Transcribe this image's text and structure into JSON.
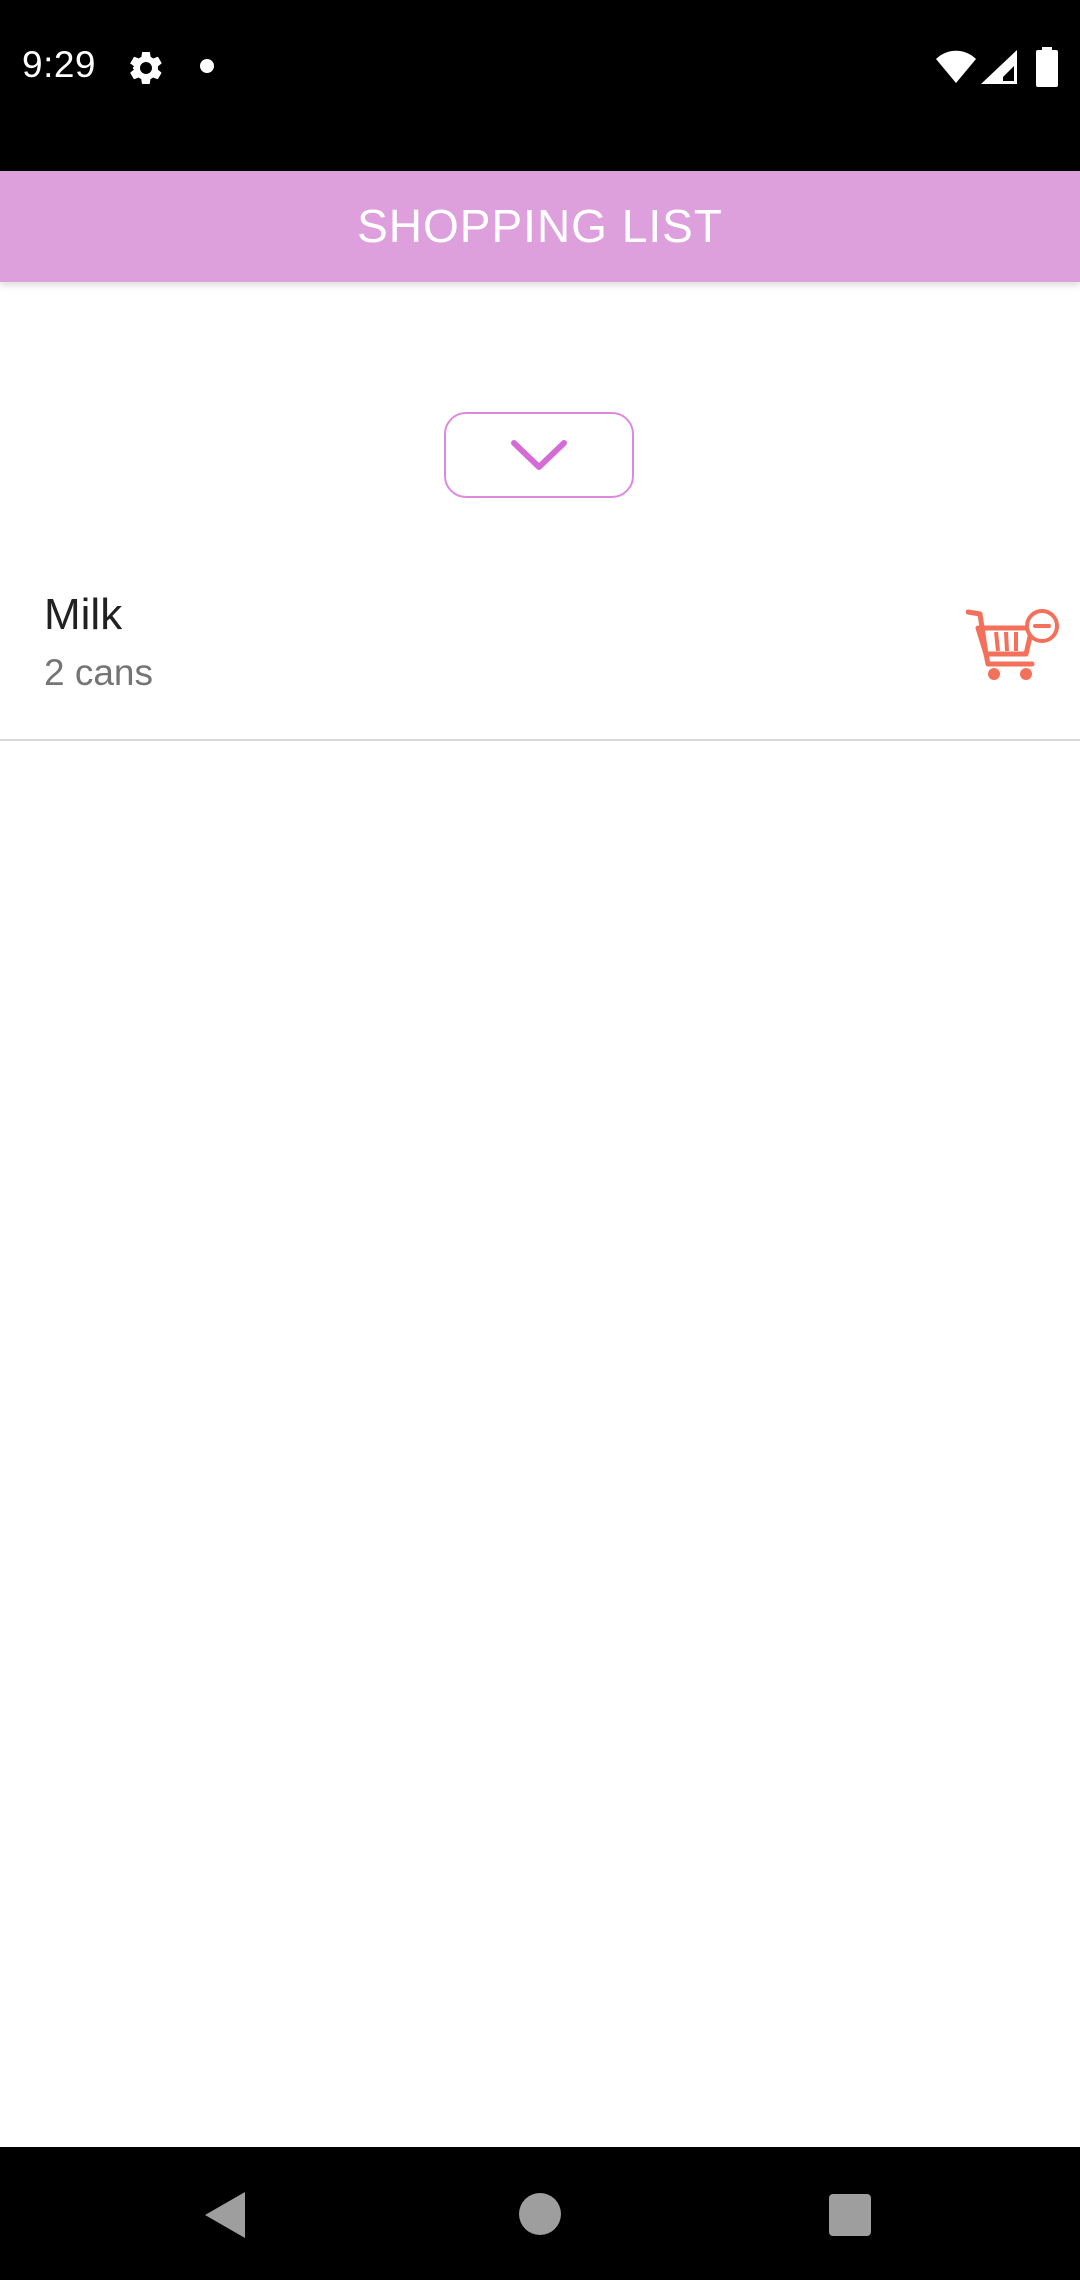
{
  "status_bar": {
    "time": "9:29",
    "icons": [
      "gear-icon",
      "notification-dot-icon",
      "wifi-icon",
      "signal-icon",
      "battery-icon"
    ]
  },
  "app_bar": {
    "title": "SHOPPING LIST",
    "background_color": "#dda0dd",
    "title_color": "#ffffff"
  },
  "toggle_button": {
    "icon": "chevron-down-icon",
    "accent_color": "#dd8ade"
  },
  "list": {
    "items": [
      {
        "name": "Milk",
        "quantity": "2 cans",
        "action_icon": "cart-remove-icon",
        "action_color": "#f4705a"
      }
    ]
  },
  "nav_bar": {
    "icons": [
      "back-icon",
      "home-icon",
      "recents-icon"
    ]
  }
}
